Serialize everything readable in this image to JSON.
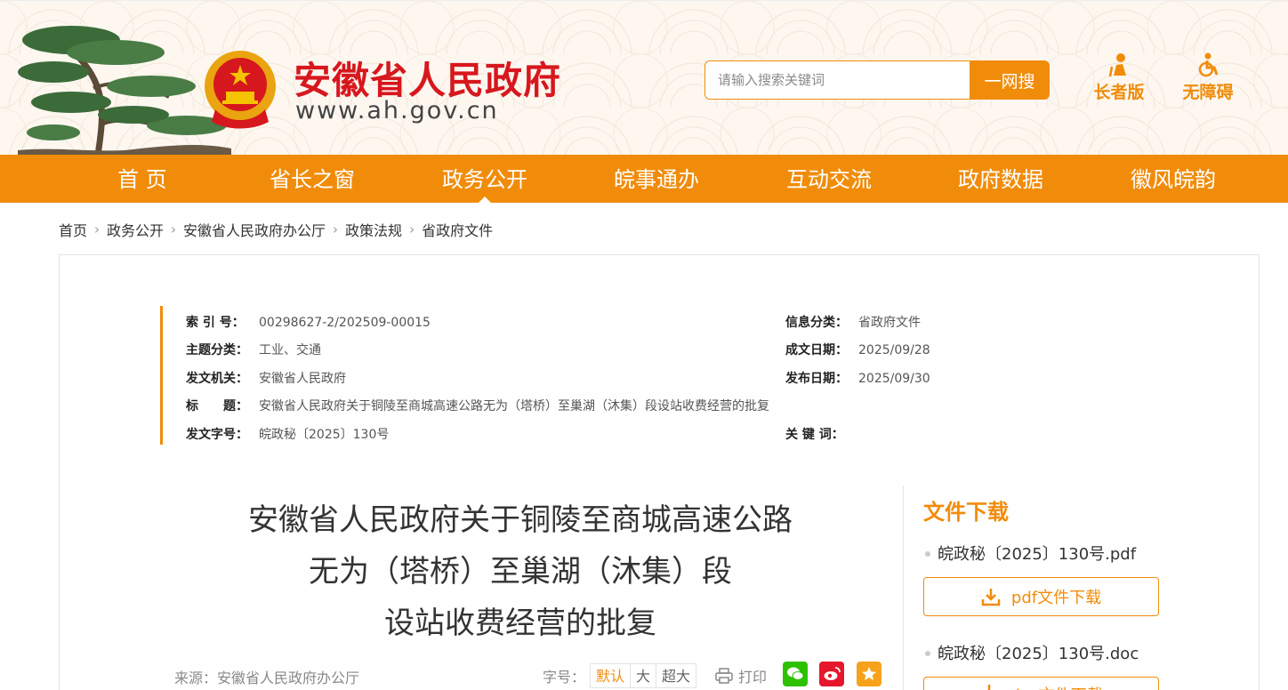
{
  "header": {
    "site_title": "安徽省人民政府",
    "site_url": "www.ah.gov.cn",
    "search": {
      "placeholder": "请输入搜索关键词",
      "button": "一网搜"
    },
    "elder_label": "长者版",
    "access_label": "无障碍",
    "colors": {
      "brand_red": "#d7171e",
      "accent_orange": "#f18c0a"
    }
  },
  "nav": {
    "items": [
      {
        "label": "首 页"
      },
      {
        "label": "省长之窗"
      },
      {
        "label": "政务公开",
        "active": true
      },
      {
        "label": "皖事通办"
      },
      {
        "label": "互动交流"
      },
      {
        "label": "政府数据"
      },
      {
        "label": "徽风皖韵"
      }
    ]
  },
  "breadcrumb": [
    "首页",
    "政务公开",
    "安徽省人民政府办公厅",
    "政策法规",
    "省政府文件"
  ],
  "meta": {
    "index_label": "索 引 号：",
    "index_value": "00298627-2/202509-00015",
    "category_label": "信息分类：",
    "category_value": "省政府文件",
    "topic_label": "主题分类：",
    "topic_value": "工业、交通",
    "written_label": "成文日期：",
    "written_value": "2025/09/28",
    "issuer_label": "发文机关：",
    "issuer_value": "安徽省人民政府",
    "published_label": "发布日期：",
    "published_value": "2025/09/30",
    "title_label": "标　　题：",
    "title_value": "安徽省人民政府关于铜陵至商城高速公路无为（塔桥）至巢湖（沐集）段设站收费经营的批复",
    "docno_label": "发文字号：",
    "docno_value": "皖政秘〔2025〕130号",
    "keywords_label": "关 键 词：",
    "keywords_value": ""
  },
  "document": {
    "title_lines": [
      "安徽省人民政府关于铜陵至商城高速公路",
      "无为（塔桥）至巢湖（沐集）段",
      "设站收费经营的批复"
    ],
    "source": "来源：安徽省人民政府办公厅",
    "font_size_label": "字号：",
    "font_sizes": [
      "默认",
      "大",
      "超大"
    ],
    "print_label": "打印"
  },
  "downloads": {
    "title": "文件下载",
    "items": [
      {
        "filename": "皖政秘〔2025〕130号.pdf",
        "button": "pdf文件下载"
      },
      {
        "filename": "皖政秘〔2025〕130号.doc",
        "button": "doc文件下载"
      }
    ]
  },
  "share": {
    "wechat_color": "#2dc100",
    "weibo_color": "#e6162d",
    "favorite_color": "#f7a21b"
  }
}
